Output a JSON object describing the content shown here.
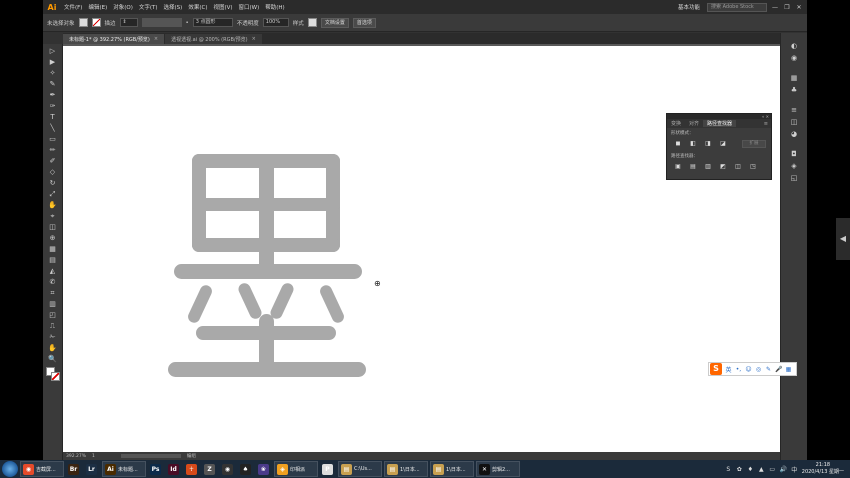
{
  "menubar": {
    "app_logo": "Ai",
    "items": [
      "文件(F)",
      "编辑(E)",
      "对象(O)",
      "文字(T)",
      "选择(S)",
      "效果(C)",
      "视图(V)",
      "窗口(W)",
      "帮助(H)"
    ],
    "workspace": "基本功能",
    "stock_search_placeholder": "搜索 Adobe Stock",
    "win_controls": [
      "—",
      "❐",
      "✕"
    ]
  },
  "controlbar": {
    "selection_label": "未选择对象",
    "stroke_label": "描边",
    "stroke_width_symbol": "⇕",
    "brush_dot": "•",
    "brush_size": "3 点圆形",
    "opacity_label": "不透明度",
    "opacity_value": "100%",
    "style_label": "样式",
    "doc_setup": "文档设置",
    "preferences": "首选项"
  },
  "tabs": [
    {
      "label": "未标题-1* @ 392.27% (RGB/预览)",
      "close": "×",
      "active": true
    },
    {
      "label": "透视透视.ai @ 200% (RGB/预览)",
      "close": "×",
      "active": false
    }
  ],
  "tools": [
    "▷",
    "▶",
    "✧",
    "✎",
    "✒",
    "✑",
    "T",
    "╲",
    "▭",
    "✏",
    "✐",
    "◇",
    "↻",
    "⤢",
    "✋",
    "⌖",
    "◫",
    "⊕",
    "▦",
    "▤",
    "◭",
    "✆",
    "⌗",
    "▥",
    "◰",
    "⎍",
    "✁",
    "✋",
    "🔍"
  ],
  "canvas": {
    "cursor": "⊕"
  },
  "pathfinder": {
    "title_controls": "«  ✕",
    "tabs": [
      "变换",
      "对齐",
      "路径查找器"
    ],
    "menu": "≡",
    "shape_modes_label": "形状模式：",
    "shape_mode_buttons": [
      "◼",
      "◧",
      "◨",
      "◪"
    ],
    "expand_label": "扩展",
    "pathfinders_label": "路径查找器：",
    "pathfinder_buttons": [
      "▣",
      "▤",
      "▥",
      "◩",
      "◫",
      "◳"
    ]
  },
  "rightstrip": {
    "icons": [
      "◐",
      "◉",
      "▦",
      "♣",
      "≡",
      "◫",
      "◕",
      "◘",
      "◈",
      "◱"
    ]
  },
  "status": {
    "zoom": "392.27%",
    "page": "1",
    "mode": "编组"
  },
  "sogou": {
    "logo": "S",
    "icons": [
      "英",
      "•,",
      "☺",
      "◎",
      "✎",
      "🎤",
      "▦"
    ]
  },
  "taskbar": {
    "items": [
      {
        "icon": "◉",
        "label": "吉截屏...",
        "color": "#e54a2a",
        "wide": true
      },
      {
        "icon": "Br",
        "label": "",
        "color": "#3a2412",
        "wide": false
      },
      {
        "icon": "Lr",
        "label": "",
        "color": "#1c2f44",
        "wide": false
      },
      {
        "icon": "Ai",
        "label": "未标题...",
        "color": "#4a2b00",
        "wide": true
      },
      {
        "icon": "Ps",
        "label": "",
        "color": "#0c2a4a",
        "wide": false
      },
      {
        "icon": "Id",
        "label": "",
        "color": "#4a0c26",
        "wide": false
      },
      {
        "icon": "☥",
        "label": "",
        "color": "#d64a1a",
        "wide": false
      },
      {
        "icon": "Z",
        "label": "",
        "color": "#555",
        "wide": false
      },
      {
        "icon": "◉",
        "label": "",
        "color": "#333",
        "wide": false
      },
      {
        "icon": "♠",
        "label": "",
        "color": "#222",
        "wide": false
      },
      {
        "icon": "❀",
        "label": "",
        "color": "#4a3a8a",
        "wide": false
      },
      {
        "icon": "◈",
        "label": "印相派",
        "color": "#f0a020",
        "wide": true
      },
      {
        "icon": "P",
        "label": "",
        "color": "#dddddd",
        "wide": false
      },
      {
        "icon": "▤",
        "label": "C:\\Us...",
        "color": "#c8a050",
        "wide": true
      },
      {
        "icon": "▤",
        "label": "1\\日本...",
        "color": "#c8a050",
        "wide": true
      },
      {
        "icon": "▤",
        "label": "1\\日本...",
        "color": "#c8a050",
        "wide": true
      },
      {
        "icon": "✕",
        "label": "剪辑2...",
        "color": "#111",
        "wide": true
      }
    ],
    "tray": [
      "S",
      "✿",
      "♦",
      "▲",
      "▭",
      "🔊",
      "中"
    ],
    "time": "21:18",
    "date": "2020/4/13 星期一"
  }
}
